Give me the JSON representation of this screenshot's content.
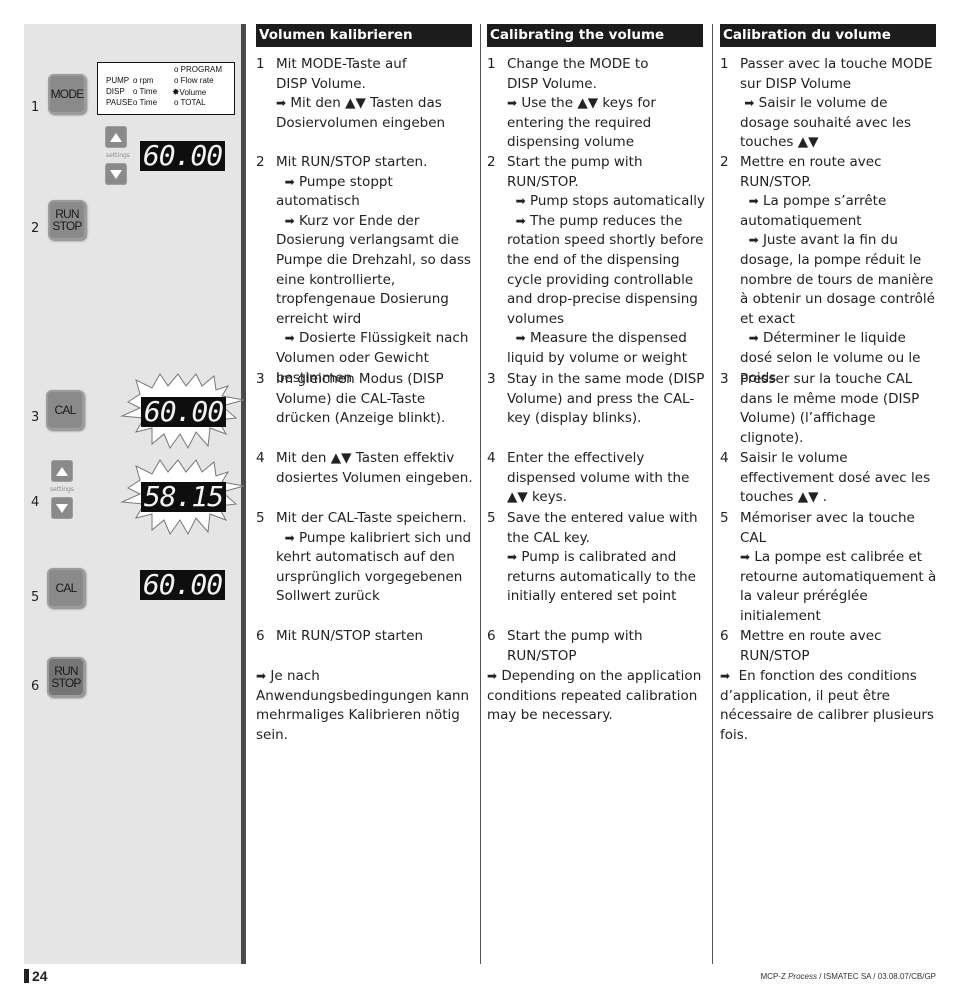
{
  "page": {
    "number": "24",
    "footer": {
      "product": "MCP-Z",
      "product_italic": "Process",
      "rest": " / ISMATEC SA / 03.08.07/CB/GP"
    }
  },
  "illustration": {
    "step_numbers": [
      "1",
      "2",
      "3",
      "4",
      "5",
      "6"
    ],
    "keys": {
      "mode": "MODE",
      "run": "RUN",
      "stop": "STOP",
      "cal": "CAL",
      "settings": "settings"
    },
    "mode_panel": {
      "left_labels": [
        "PUMP",
        "DISP",
        "PAUSE"
      ],
      "mid_labels": [
        "rpm",
        "Time",
        "Time"
      ],
      "right_labels": [
        "PROGRAM",
        "Flow rate",
        "Volume",
        "TOTAL"
      ],
      "active": "Volume"
    },
    "displays": {
      "step1": "60.00",
      "step3": "60.00",
      "step4": "58.15",
      "step5": "60.00"
    }
  },
  "columns": {
    "de": {
      "title": "Volumen kalibrieren",
      "steps": [
        {
          "n": "1",
          "lines": [
            "Mit MODE-Taste auf",
            "DISP Volume."
          ],
          "arrow": "Mit den ▲▼ Tasten das Dosiervolumen eingeben"
        },
        {
          "n": "2",
          "lines": [
            "Mit RUN/STOP starten."
          ],
          "arrows": [
            "Pumpe stoppt automatisch",
            "Kurz vor Ende der Dosierung verlangsamt die Pumpe die Drehzahl, so dass eine kontrollierte, tropfengenaue Dosierung erreicht wird",
            "Dosierte Flüssigkeit nach Volumen oder Gewicht bestimmen"
          ]
        },
        {
          "n": "3",
          "text": "Im gleichen Modus (DISP Volume) die CAL-Taste drücken (Anzeige blinkt)."
        },
        {
          "n": "4",
          "text": "Mit den ▲▼ Tasten effektiv dosiertes Volumen eingeben."
        },
        {
          "n": "5",
          "text": "Mit der CAL-Taste speichern.",
          "arrow": "Pumpe kalibriert sich und kehrt automatisch auf den ursprünglich vorgegebenen Sollwert zurück"
        },
        {
          "n": "6",
          "text": "Mit RUN/STOP starten"
        }
      ],
      "note": "Je nach Anwendungsbedingungen kann mehrmaliges Kalibrieren nötig sein."
    },
    "en": {
      "title": "Calibrating the volume",
      "steps": [
        {
          "n": "1",
          "lines": [
            "Change the MODE to",
            "DISP Volume."
          ],
          "arrow": "Use the ▲▼ keys for entering the required dispensing volume"
        },
        {
          "n": "2",
          "lines": [
            "Start the pump with RUN/STOP."
          ],
          "arrows": [
            "Pump stops automatically",
            "The pump reduces the rotation speed shortly before the end of the dispensing cycle providing controllable and drop-precise dispensing volumes",
            "Measure the dispensed liquid by volume or weight"
          ]
        },
        {
          "n": "3",
          "text": "Stay in the same mode (DISP Volume) and press the CAL-key (display blinks)."
        },
        {
          "n": "4",
          "text": "Enter the effectively dispensed volume with the ▲▼ keys."
        },
        {
          "n": "5",
          "text": "Save the entered value with the CAL key.",
          "arrow": "Pump is calibrated and returns automatically to the initially entered set point"
        },
        {
          "n": "6",
          "text": "Start the pump with RUN/STOP"
        }
      ],
      "note": "Depending on the application conditions repeated calibration may be necessary."
    },
    "fr": {
      "title": "Calibration du volume",
      "steps": [
        {
          "n": "1",
          "lines": [
            "Passer avec la touche MODE",
            "sur DISP Volume"
          ],
          "arrow": "Saisir le volume de dosage souhaité avec les touches ▲▼"
        },
        {
          "n": "2",
          "lines": [
            "Mettre en route avec RUN/STOP."
          ],
          "arrows": [
            "La pompe s’arrête automatiquement",
            "Juste avant la fin du dosage, la pompe réduit le nombre de tours de manière à obtenir un dosage contrôlé et exact",
            "Déterminer le liquide dosé selon le volume ou le poids"
          ]
        },
        {
          "n": "3",
          "text": "Presser sur la touche CAL dans le même mode (DISP Volume) (l’affichage clignote)."
        },
        {
          "n": "4",
          "text": "Saisir le volume effectivement dosé avec les touches ▲▼ ."
        },
        {
          "n": "5",
          "text": "Mémoriser avec la touche CAL",
          "arrow": "La pompe est calibrée et retourne automatiquement à la valeur préréglée initialement"
        },
        {
          "n": "6",
          "text": "Mettre en route avec RUN/STOP"
        }
      ],
      "note": "En fonction des conditions d’application, il peut être nécessaire de calibrer plusieurs fois."
    }
  },
  "icons": {
    "arrow": "➡",
    "up_down": "▲▼"
  }
}
